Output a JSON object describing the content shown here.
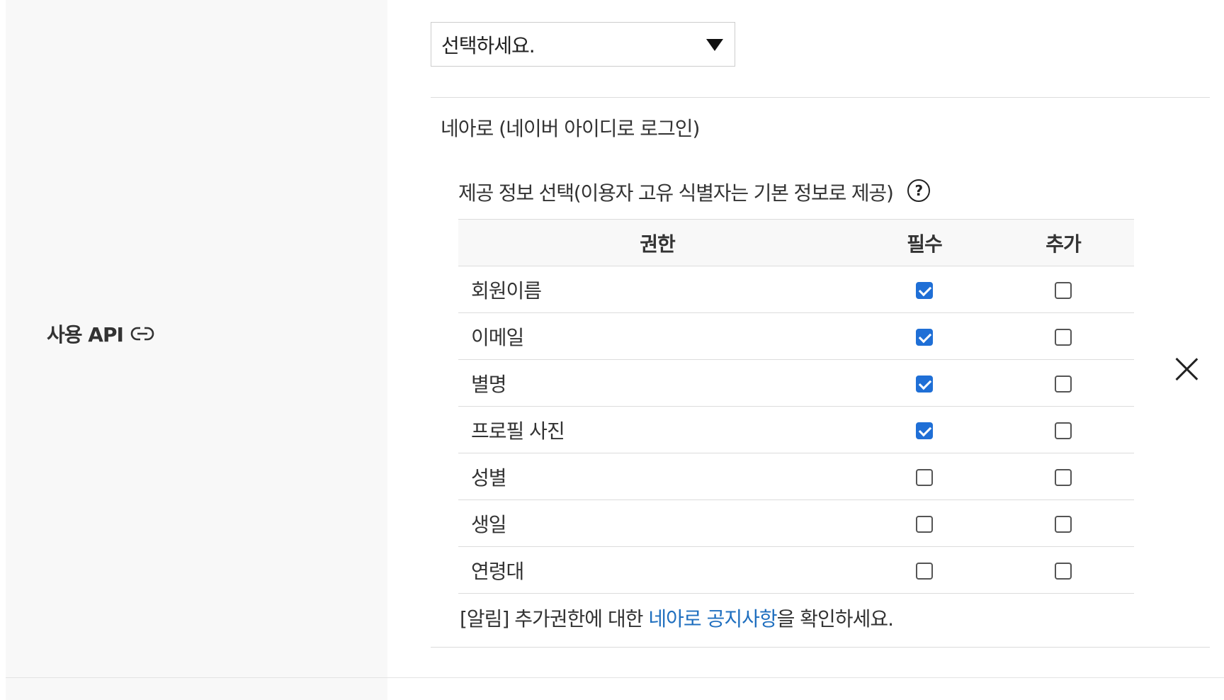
{
  "section": {
    "label": "사용 API",
    "link_icon": "link-icon"
  },
  "select": {
    "value": "선택하세요.",
    "icon": "caret-down-icon"
  },
  "api": {
    "name": "네아로 (네이버 아이디로 로그인)",
    "info_title": "제공 정보 선택(이용자 고유 식별자는 기본 정보로 제공)",
    "help_icon_glyph": "?",
    "columns": [
      "권한",
      "필수",
      "추가"
    ],
    "rows": [
      {
        "name": "회원이름",
        "required": true,
        "additional": false
      },
      {
        "name": "이메일",
        "required": true,
        "additional": false
      },
      {
        "name": "별명",
        "required": true,
        "additional": false
      },
      {
        "name": "프로필 사진",
        "required": true,
        "additional": false
      },
      {
        "name": "성별",
        "required": false,
        "additional": false
      },
      {
        "name": "생일",
        "required": false,
        "additional": false
      },
      {
        "name": "연령대",
        "required": false,
        "additional": false
      }
    ],
    "notice_prefix": "[알림] 추가권한에 대한 ",
    "notice_link": "네아로 공지사항",
    "notice_suffix": "을 확인하세요.",
    "close_icon": "close-icon"
  },
  "colors": {
    "checkbox_checked": "#1f6fd6",
    "link": "#1f6fbf",
    "left_panel_bg": "#f8f8f8"
  }
}
